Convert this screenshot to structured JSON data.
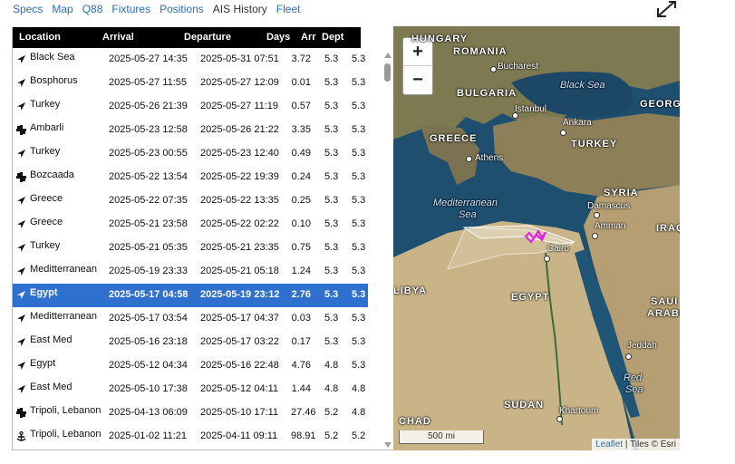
{
  "nav": {
    "tabs": [
      {
        "label": "Specs",
        "active": false
      },
      {
        "label": "Map",
        "active": false
      },
      {
        "label": "Q88",
        "active": false
      },
      {
        "label": "Fixtures",
        "active": false
      },
      {
        "label": "Positions",
        "active": false
      },
      {
        "label": "AIS History",
        "active": true
      },
      {
        "label": "Fleet",
        "active": false
      }
    ]
  },
  "table": {
    "headers": {
      "location": "Location",
      "arrival": "Arrival",
      "departure": "Departure",
      "days": "Days",
      "arr": "Arr",
      "dept": "Dept"
    },
    "selected_index": 10,
    "rows": [
      {
        "icon": "arrow-icon",
        "location": "Black Sea",
        "arrival": "2025-05-27 14:35",
        "departure": "2025-05-31 07:51",
        "days": "3.72",
        "arr": "5.3",
        "dept": "5.3"
      },
      {
        "icon": "arrow-icon",
        "location": "Bosphorus",
        "arrival": "2025-05-27 11:55",
        "departure": "2025-05-27 12:09",
        "days": "0.01",
        "arr": "5.3",
        "dept": "5.3"
      },
      {
        "icon": "arrow-icon",
        "location": "Turkey",
        "arrival": "2025-05-26 21:39",
        "departure": "2025-05-27 11:19",
        "days": "0.57",
        "arr": "5.3",
        "dept": "5.3"
      },
      {
        "icon": "anchorage-icon",
        "location": "Ambarli",
        "arrival": "2025-05-23 12:58",
        "departure": "2025-05-26 21:22",
        "days": "3.35",
        "arr": "5.3",
        "dept": "5.3"
      },
      {
        "icon": "arrow-icon",
        "location": "Turkey",
        "arrival": "2025-05-23 00:55",
        "departure": "2025-05-23 12:40",
        "days": "0.49",
        "arr": "5.3",
        "dept": "5.3"
      },
      {
        "icon": "anchorage-icon",
        "location": "Bozcaada",
        "arrival": "2025-05-22 13:54",
        "departure": "2025-05-22 19:39",
        "days": "0.24",
        "arr": "5.3",
        "dept": "5.3"
      },
      {
        "icon": "arrow-icon",
        "location": "Greece",
        "arrival": "2025-05-22 07:35",
        "departure": "2025-05-22 13:35",
        "days": "0.25",
        "arr": "5.3",
        "dept": "5.3"
      },
      {
        "icon": "arrow-icon",
        "location": "Greece",
        "arrival": "2025-05-21 23:58",
        "departure": "2025-05-22 02:22",
        "days": "0.10",
        "arr": "5.3",
        "dept": "5.3"
      },
      {
        "icon": "arrow-icon",
        "location": "Turkey",
        "arrival": "2025-05-21 05:35",
        "departure": "2025-05-21 23:35",
        "days": "0.75",
        "arr": "5.3",
        "dept": "5.3"
      },
      {
        "icon": "arrow-icon",
        "location": "Meditterranean",
        "arrival": "2025-05-19 23:33",
        "departure": "2025-05-21 05:18",
        "days": "1.24",
        "arr": "5.3",
        "dept": "5.3"
      },
      {
        "icon": "arrow-icon",
        "location": "Egypt",
        "arrival": "2025-05-17 04:58",
        "departure": "2025-05-19 23:12",
        "days": "2.76",
        "arr": "5.3",
        "dept": "5.3"
      },
      {
        "icon": "arrow-icon",
        "location": "Meditterranean",
        "arrival": "2025-05-17 03:54",
        "departure": "2025-05-17 04:37",
        "days": "0.03",
        "arr": "5.3",
        "dept": "5.3"
      },
      {
        "icon": "arrow-icon",
        "location": "East Med",
        "arrival": "2025-05-16 23:18",
        "departure": "2025-05-17 03:22",
        "days": "0.17",
        "arr": "5.3",
        "dept": "5.3"
      },
      {
        "icon": "arrow-icon",
        "location": "Egypt",
        "arrival": "2025-05-12 04:34",
        "departure": "2025-05-16 22:48",
        "days": "4.76",
        "arr": "4.8",
        "dept": "5.3"
      },
      {
        "icon": "arrow-icon",
        "location": "East Med",
        "arrival": "2025-05-10 17:38",
        "departure": "2025-05-12 04:11",
        "days": "1.44",
        "arr": "4.8",
        "dept": "4.8"
      },
      {
        "icon": "anchorage-icon",
        "location": "Tripoli, Lebanon",
        "arrival": "2025-04-13 06:09",
        "departure": "2025-05-10 17:11",
        "days": "27.46",
        "arr": "5.2",
        "dept": "4.8"
      },
      {
        "icon": "port-icon",
        "location": "Tripoli, Lebanon",
        "arrival": "2025-01-02 11:21",
        "departure": "2025-04-11 09:11",
        "days": "98.91",
        "arr": "5.2",
        "dept": "5.2"
      }
    ]
  },
  "map": {
    "zoom_in": "+",
    "zoom_out": "−",
    "scale": "500 mi",
    "attribution_link": "Leaflet",
    "attribution_text": " | Tiles © Esri",
    "labels": {
      "hungary": "HUNGARY",
      "romania": "ROMANIA",
      "bucharest": "Bucharest",
      "bulgaria": "BULGARIA",
      "blacksea": "Black Sea",
      "istanbul": "Istanbul",
      "ankara": "Ankara",
      "georgia": "GEORG",
      "greece": "GREECE",
      "turkey": "TURKEY",
      "athens": "Athens",
      "syria": "SYRIA",
      "med1": "Mediterranean",
      "med2": "Sea",
      "damascus": "Damascus",
      "amman": "Amman",
      "iraq": "IRAQ",
      "cairo": "Cairo",
      "libya": "LIBYA",
      "egypt": "EGYPT",
      "saudi1": "SAUI",
      "saudi2": "ARABI",
      "jeddah": "Jeddah",
      "red1": "Red",
      "red2": "Sea",
      "sudan": "SUDAN",
      "khartoum": "Khartoum",
      "chad": "CHAD"
    },
    "colors": {
      "sea": "#1f4f6e",
      "land": "#9a8a66",
      "desert": "#c9b487",
      "track": "#e020e0"
    }
  }
}
